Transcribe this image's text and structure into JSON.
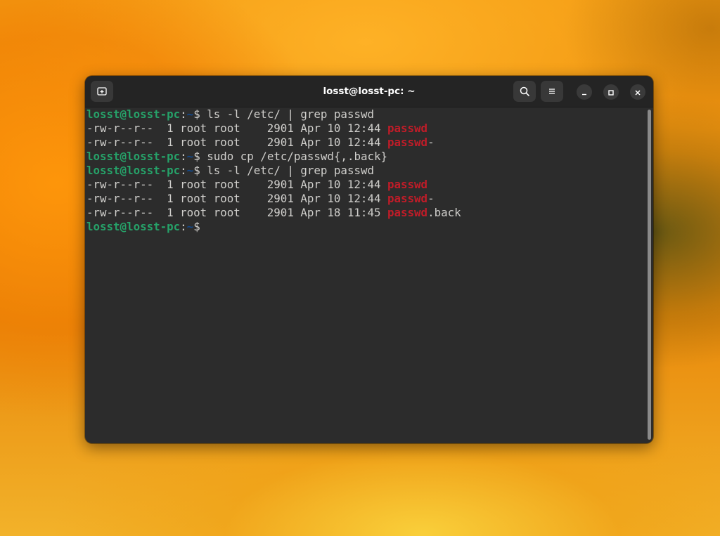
{
  "window": {
    "title": "losst@losst-pc: ~"
  },
  "header": {
    "new_tab_icon": "new-tab-icon",
    "search_icon": "search-icon",
    "menu_icon": "hamburger-menu-icon",
    "minimize_icon": "minimize-icon",
    "maximize_icon": "maximize-icon",
    "close_icon": "close-icon"
  },
  "terminal": {
    "lines": [
      {
        "kind": "prompt",
        "user": "losst@losst-pc",
        "sep": ":",
        "path": "~",
        "sym": "$ ",
        "cmd": "ls -l /etc/ | grep passwd"
      },
      {
        "kind": "output",
        "pre": "-rw-r--r--  1 root root    2901 Apr 10 12:44 ",
        "hl": "passwd",
        "post": ""
      },
      {
        "kind": "output",
        "pre": "-rw-r--r--  1 root root    2901 Apr 10 12:44 ",
        "hl": "passwd",
        "post": "-"
      },
      {
        "kind": "prompt",
        "user": "losst@losst-pc",
        "sep": ":",
        "path": "~",
        "sym": "$ ",
        "cmd": "sudo cp /etc/passwd{,.back}"
      },
      {
        "kind": "prompt",
        "user": "losst@losst-pc",
        "sep": ":",
        "path": "~",
        "sym": "$ ",
        "cmd": "ls -l /etc/ | grep passwd"
      },
      {
        "kind": "output",
        "pre": "-rw-r--r--  1 root root    2901 Apr 10 12:44 ",
        "hl": "passwd",
        "post": ""
      },
      {
        "kind": "output",
        "pre": "-rw-r--r--  1 root root    2901 Apr 10 12:44 ",
        "hl": "passwd",
        "post": "-"
      },
      {
        "kind": "output",
        "pre": "-rw-r--r--  1 root root    2901 Apr 18 11:45 ",
        "hl": "passwd",
        "post": ".back"
      },
      {
        "kind": "prompt",
        "user": "losst@losst-pc",
        "sep": ":",
        "path": "~",
        "sym": "$",
        "cmd": ""
      }
    ]
  },
  "colors": {
    "prompt_user": "#26a269",
    "prompt_path": "#12488b",
    "grep_match": "#c01c28",
    "text": "#d0cfcc",
    "background": "#2c2c2c"
  }
}
